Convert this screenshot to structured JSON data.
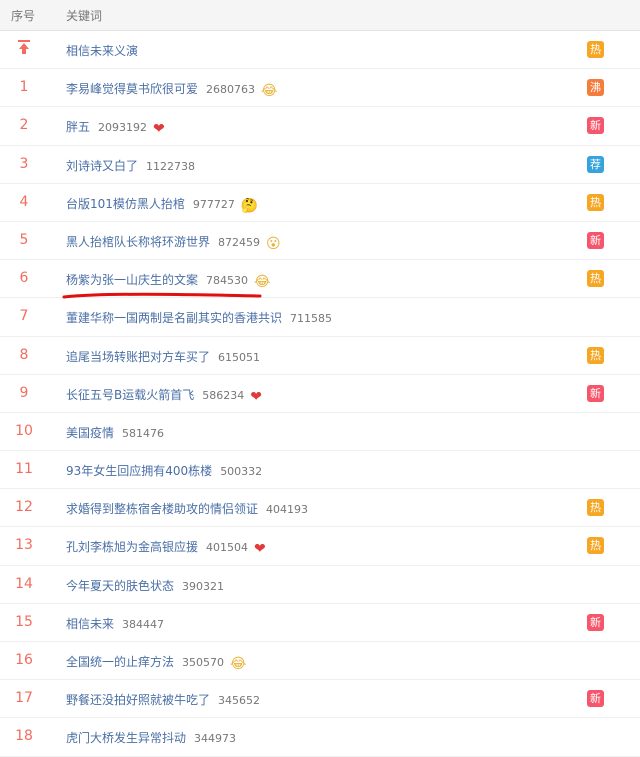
{
  "header": {
    "rank_label": "序号",
    "keyword_label": "关键词"
  },
  "colors": {
    "hot": "#f5a623",
    "new": "#f5566b",
    "boil": "#f47c3c",
    "recommend": "#36a3dd",
    "pin": "#f26d5f",
    "link": "#4a6fa5",
    "annotation": "#e01010"
  },
  "rows": [
    {
      "rank": "",
      "pinned": true,
      "keyword": "相信未来义演",
      "count": "",
      "emoji": "",
      "tag": "热",
      "tag_type": "hot"
    },
    {
      "rank": "1",
      "keyword": "李易峰觉得莫书欣很可爱",
      "count": "2680763",
      "emoji": "😂",
      "tag": "沸",
      "tag_type": "boil"
    },
    {
      "rank": "2",
      "keyword": "胖五",
      "count": "2093192",
      "emoji": "❤",
      "tag": "新",
      "tag_type": "new"
    },
    {
      "rank": "3",
      "keyword": "刘诗诗又白了",
      "count": "1122738",
      "emoji": "",
      "tag": "荐",
      "tag_type": "recommend"
    },
    {
      "rank": "4",
      "keyword": "台版101模仿黑人抬棺",
      "count": "977727",
      "emoji": "🤔",
      "tag": "热",
      "tag_type": "hot"
    },
    {
      "rank": "5",
      "keyword": "黑人抬棺队长称将环游世界",
      "count": "872459",
      "emoji": "😮",
      "tag": "新",
      "tag_type": "new"
    },
    {
      "rank": "6",
      "keyword": "杨紫为张一山庆生的文案",
      "count": "784530",
      "emoji": "😂",
      "tag": "热",
      "tag_type": "hot"
    },
    {
      "rank": "7",
      "keyword": "董建华称一国两制是名副其实的香港共识",
      "count": "711585",
      "emoji": "",
      "tag": "",
      "tag_type": ""
    },
    {
      "rank": "8",
      "keyword": "追尾当场转账把对方车买了",
      "count": "615051",
      "emoji": "",
      "tag": "热",
      "tag_type": "hot"
    },
    {
      "rank": "9",
      "keyword": "长征五号B运载火箭首飞",
      "count": "586234",
      "emoji": "❤",
      "tag": "新",
      "tag_type": "new"
    },
    {
      "rank": "10",
      "keyword": "美国疫情",
      "count": "581476",
      "emoji": "",
      "tag": "",
      "tag_type": ""
    },
    {
      "rank": "11",
      "keyword": "93年女生回应拥有400栋楼",
      "count": "500332",
      "emoji": "",
      "tag": "",
      "tag_type": ""
    },
    {
      "rank": "12",
      "keyword": "求婚得到整栋宿舍楼助攻的情侣领证",
      "count": "404193",
      "emoji": "",
      "tag": "热",
      "tag_type": "hot"
    },
    {
      "rank": "13",
      "keyword": "孔刘李栋旭为金高银应援",
      "count": "401504",
      "emoji": "❤",
      "tag": "热",
      "tag_type": "hot"
    },
    {
      "rank": "14",
      "keyword": "今年夏天的肤色状态",
      "count": "390321",
      "emoji": "",
      "tag": "",
      "tag_type": ""
    },
    {
      "rank": "15",
      "keyword": "相信未来",
      "count": "384447",
      "emoji": "",
      "tag": "新",
      "tag_type": "new"
    },
    {
      "rank": "16",
      "keyword": "全国统一的止痒方法",
      "count": "350570",
      "emoji": "😂",
      "tag": "",
      "tag_type": ""
    },
    {
      "rank": "17",
      "keyword": "野餐还没拍好照就被牛吃了",
      "count": "345652",
      "emoji": "",
      "tag": "新",
      "tag_type": "new"
    },
    {
      "rank": "18",
      "keyword": "虎门大桥发生异常抖动",
      "count": "344973",
      "emoji": "",
      "tag": "",
      "tag_type": ""
    }
  ]
}
